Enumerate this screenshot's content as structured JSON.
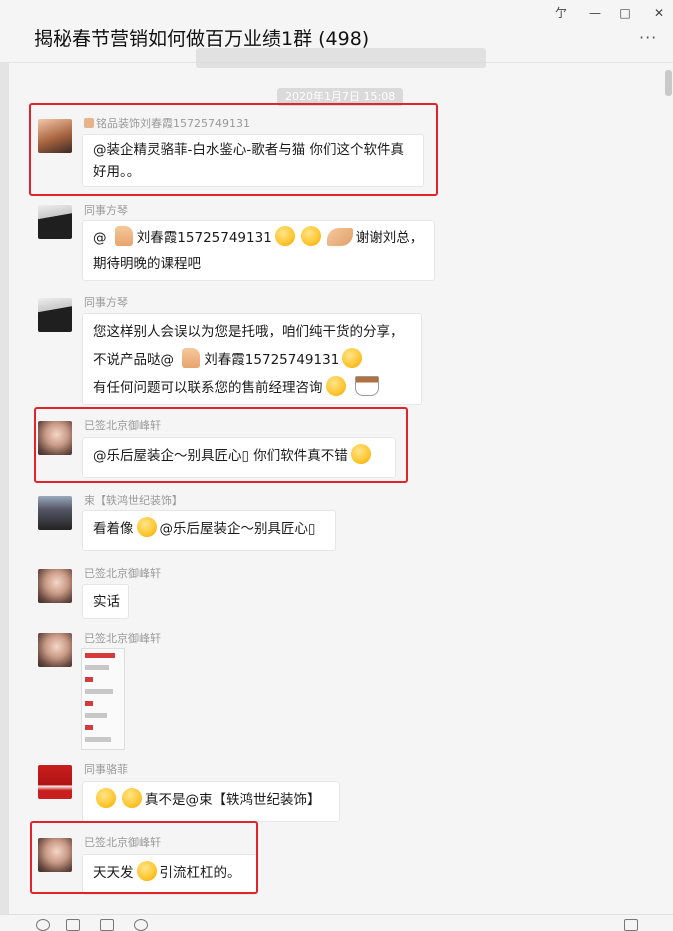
{
  "window": {
    "title": "揭秘春节营销如何做百万业绩1群 (498)",
    "controls": {
      "pin": "亇",
      "minimize": "—",
      "maximize": "□",
      "close": "✕"
    },
    "more": "···"
  },
  "timestamp": "2020年1月7日 15:08",
  "messages": [
    {
      "sender": "铭品装饰刘春霞15725749131",
      "lines": [
        "@装企精灵骆菲-白水鉴心-歌者与猫 你们这个软件真",
        "好用。。"
      ]
    },
    {
      "sender": "同事方琴",
      "lines": [
        "@ ",
        "刘春霞15725749131",
        "谢谢刘总，",
        "期待明晚的课程吧"
      ]
    },
    {
      "sender": "同事方琴",
      "lines": [
        "您这样别人会误以为您是托哦，咱们纯干货的分享，",
        "不说产品哒@ ",
        "刘春霞15725749131",
        "有任何问题可以联系您的售前经理咨询"
      ]
    },
    {
      "sender": "已签北京御峰轩",
      "lines": [
        "@乐后屋装企～别具匠心▯ 你们软件真不错"
      ]
    },
    {
      "sender": "束【轶鸿世纪装饰】",
      "lines": [
        "看着像",
        "@乐后屋装企～别具匠心▯"
      ]
    },
    {
      "sender": "已签北京御峰轩",
      "lines": [
        "实话"
      ]
    },
    {
      "sender": "已签北京御峰轩"
    },
    {
      "sender": "同事骆菲",
      "lines": [
        "真不是@束【轶鸿世纪装饰】"
      ]
    },
    {
      "sender": "已签北京御峰轩",
      "lines": [
        "天天发",
        "引流杠杠的。"
      ]
    }
  ],
  "colors": {
    "highlight_box": "#e0242a",
    "bubble": "#ffffff",
    "background": "#f5f5f5"
  }
}
